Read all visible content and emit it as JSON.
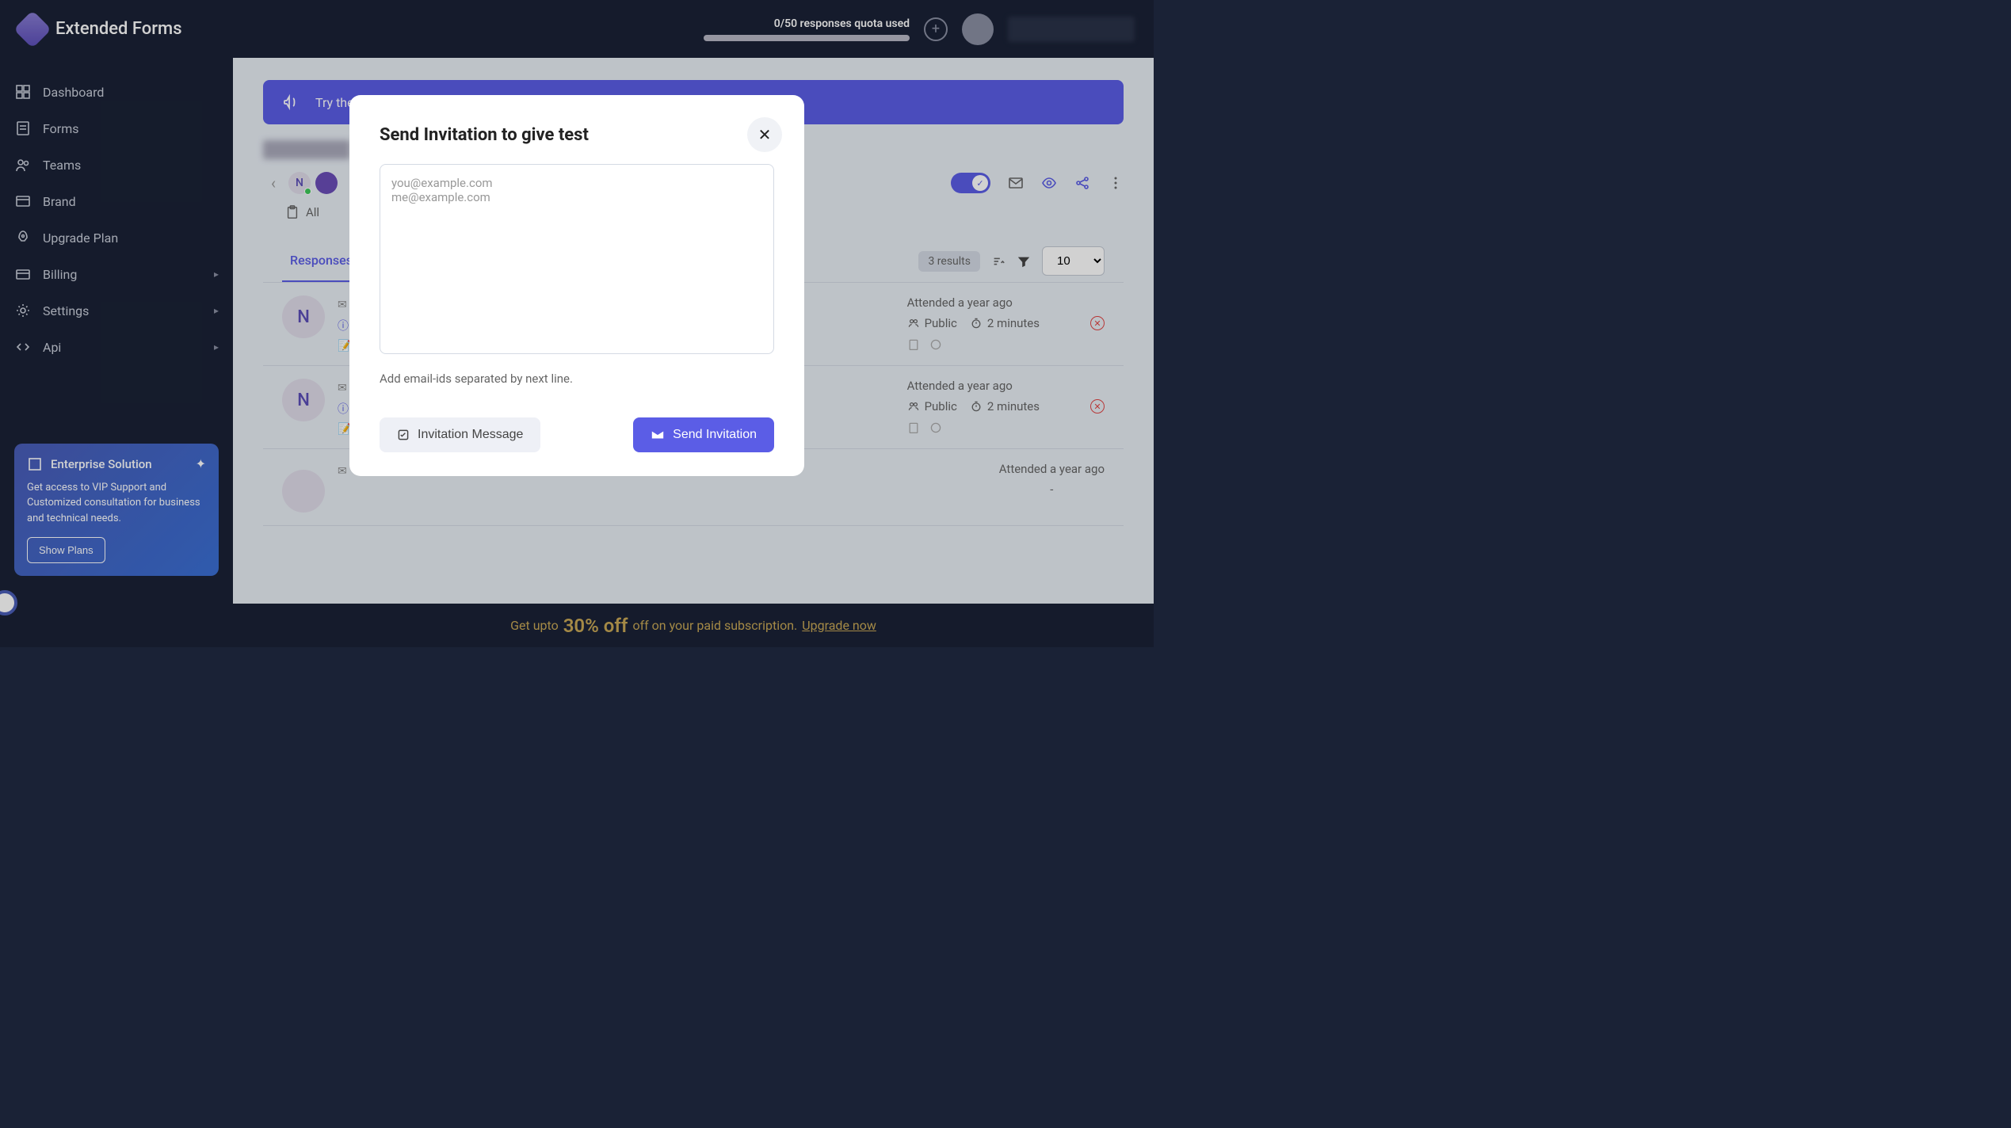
{
  "brand": "Extended Forms",
  "quota": "0/50 responses quota used",
  "sidebar": {
    "items": [
      {
        "label": "Dashboard"
      },
      {
        "label": "Forms"
      },
      {
        "label": "Teams"
      },
      {
        "label": "Brand"
      },
      {
        "label": "Upgrade Plan"
      },
      {
        "label": "Billing"
      },
      {
        "label": "Settings"
      },
      {
        "label": "Api"
      }
    ]
  },
  "enterprise": {
    "title": "Enterprise Solution",
    "desc": "Get access to VIP Support and Customized consultation for business and technical needs.",
    "button": "Show Plans"
  },
  "banner": "Try the Extended Forms features with premium offers.",
  "form": {
    "all_label": "All"
  },
  "tabs": {
    "responses": "Responses",
    "results_count": "3 results",
    "page_size": "10"
  },
  "responses": [
    {
      "initial": "N",
      "attended": "Attended a year ago",
      "visibility": "Public",
      "duration": "2 minutes"
    },
    {
      "initial": "N",
      "attended": "Attended a year ago",
      "visibility": "Public",
      "duration": "2 minutes"
    },
    {
      "initial": "",
      "attended": "Attended a year ago",
      "visibility": "-",
      "duration": ""
    }
  ],
  "bottom": {
    "pre": "Get upto",
    "pct": "30% off",
    "post": "off on your paid subscription.",
    "link": "Upgrade now"
  },
  "modal": {
    "title": "Send Invitation to give test",
    "placeholder": "you@example.com\nme@example.com",
    "hint": "Add email-ids separated by next line.",
    "secondary": "Invitation Message",
    "primary": "Send Invitation"
  }
}
